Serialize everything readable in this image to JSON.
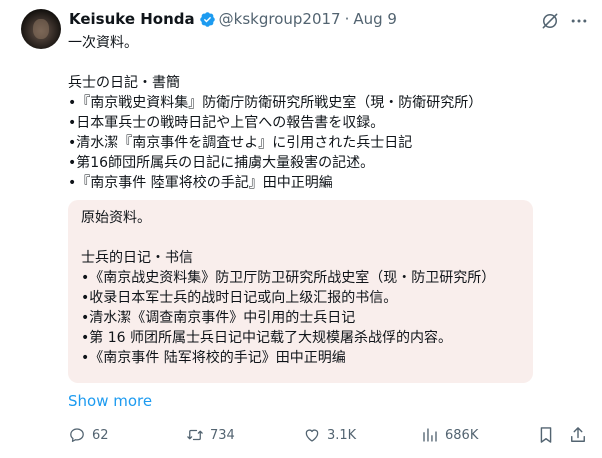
{
  "author": {
    "name": "Keisuke Honda",
    "handle": "@kskgroup2017",
    "separator": "·",
    "date": "Aug 9",
    "verified_color": "#1d9bf0",
    "avatar_icon": "avatar-photo"
  },
  "tweet": {
    "text": "一次資料。\n\n兵士の日記・書簡\n•『南京戦史資料集』防衛庁防衛研究所戦史室（現・防衛研究所）\n•日本軍兵士の戦時日記や上官への報告書を収録。\n•清水潔『南京事件を調査せよ』に引用された兵士日記\n•第16師団所属兵の日記に捕虜大量殺害の記述。\n•『南京事件 陸軍将校の手記』田中正明編",
    "translation": "原始资料。\n\n士兵的日记・书信\n•《南京战史资料集》防卫厅防卫研究所战史室（现・防卫研究所）\n•收录日本军士兵的战时日记或向上级汇报的书信。\n•清水潔《调查南京事件》中引用的士兵日记\n•第 16 师团所属士兵日记中记载了大规模屠杀战俘的内容。\n•《南京事件 陆军将校的手记》田中正明编",
    "show_more": "Show more",
    "card_bg": "#f9eeec",
    "link_color": "#1d9bf0"
  },
  "actions": {
    "replies": "62",
    "reposts": "734",
    "likes": "3.1K",
    "views": "686K"
  },
  "icons": [
    "grok-icon",
    "more-icon",
    "reply-icon",
    "repost-icon",
    "like-icon",
    "views-icon",
    "bookmark-icon",
    "share-icon"
  ]
}
